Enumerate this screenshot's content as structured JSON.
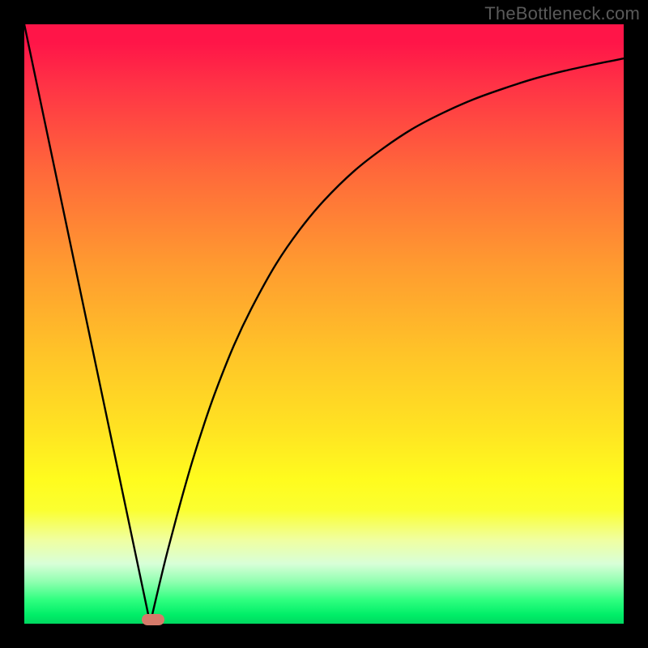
{
  "watermark": "TheBottleneck.com",
  "colors": {
    "curve_stroke": "#000000",
    "marker_fill": "#d67a6a",
    "background_black": "#000000"
  },
  "chart_data": {
    "type": "line",
    "title": "",
    "xlabel": "",
    "ylabel": "",
    "xlim": [
      0,
      100
    ],
    "ylim": [
      0,
      100
    ],
    "x": [
      0,
      2,
      4,
      6,
      8,
      10,
      12,
      14,
      16,
      18,
      20,
      21,
      22,
      23,
      24,
      26,
      28,
      30,
      32,
      35,
      38,
      42,
      46,
      50,
      55,
      60,
      65,
      70,
      75,
      80,
      85,
      90,
      95,
      100
    ],
    "y": [
      100,
      90.5,
      81,
      71.5,
      62,
      52.4,
      42.9,
      33.4,
      23.8,
      14.3,
      4.8,
      0,
      4.3,
      8.5,
      12.5,
      20,
      27,
      33.3,
      39,
      46.5,
      52.8,
      60,
      65.8,
      70.6,
      75.5,
      79.4,
      82.7,
      85.3,
      87.5,
      89.3,
      90.9,
      92.2,
      93.3,
      94.3
    ],
    "minimum": {
      "x": 21,
      "y": 0
    },
    "marker": {
      "x": 21.5,
      "y": 0.7
    }
  }
}
